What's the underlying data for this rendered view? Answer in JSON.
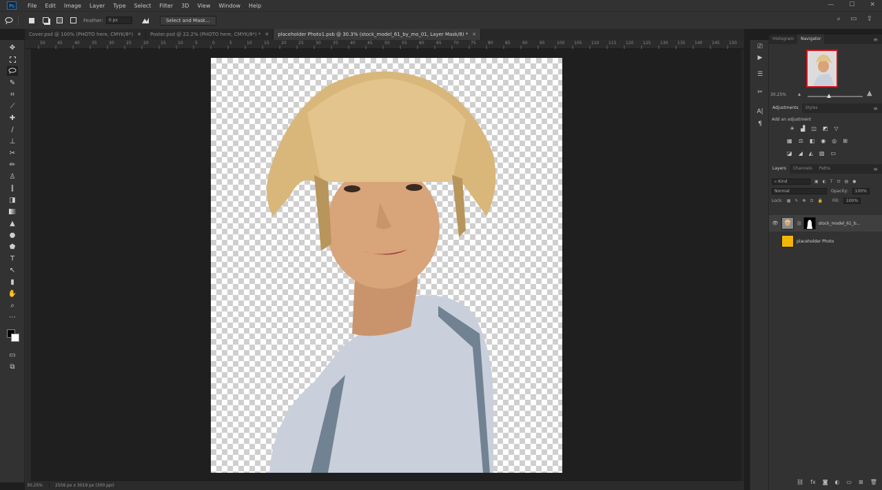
{
  "app": {
    "logo": "Ps"
  },
  "menu": [
    "File",
    "Edit",
    "Image",
    "Layer",
    "Type",
    "Select",
    "Filter",
    "3D",
    "View",
    "Window",
    "Help"
  ],
  "window_controls": [
    "—",
    "☐",
    "✕"
  ],
  "options_bar": {
    "feather_label": "Feather:",
    "feather_value": "0 px",
    "select_and_mask": "Select and Mask..."
  },
  "tabs": [
    {
      "label": "Cover.psd @ 100% (PHOTO here, CMYK/8*)",
      "active": false
    },
    {
      "label": "Poster.psd @ 22.2% (PHOTO here, CMYK/8*) *",
      "active": false
    },
    {
      "label": "placeholder Photo1.psb @ 30.3% (stock_model_61_by_mo_01, Layer Mask/8) *",
      "active": true
    }
  ],
  "ruler_labels": [
    "50",
    "45",
    "40",
    "35",
    "30",
    "25",
    "20",
    "15",
    "10",
    "5",
    "0",
    "5",
    "10",
    "15",
    "20",
    "25",
    "30",
    "35",
    "40",
    "45",
    "50",
    "55",
    "60",
    "65",
    "70",
    "75",
    "80",
    "85",
    "90",
    "95",
    "100",
    "105",
    "110",
    "115",
    "120",
    "125",
    "130",
    "135",
    "140",
    "145",
    "150"
  ],
  "status": {
    "zoom": "30.25%",
    "info": "2556 px x 3019 px (300 ppi)"
  },
  "navigator": {
    "tabs": [
      "Histogram",
      "Navigator"
    ],
    "zoom": "30.25%"
  },
  "adjustments": {
    "tabs": [
      "Adjustments",
      "Styles"
    ],
    "heading": "Add an adjustment"
  },
  "layers": {
    "tabs": [
      "Layers",
      "Channels",
      "Paths"
    ],
    "kind": "Kind",
    "blend_mode": "Normal",
    "opacity_label": "Opacity:",
    "opacity_value": "100%",
    "lock_label": "Lock:",
    "fill_label": "Fill:",
    "fill_value": "100%",
    "items": [
      {
        "name": "stock_model_61_b...",
        "selected": true
      },
      {
        "name": "placeholder Photo",
        "selected": false
      }
    ]
  },
  "colors": {
    "accent_red": "#d0141a",
    "placeholder_yellow": "#f2b705"
  }
}
